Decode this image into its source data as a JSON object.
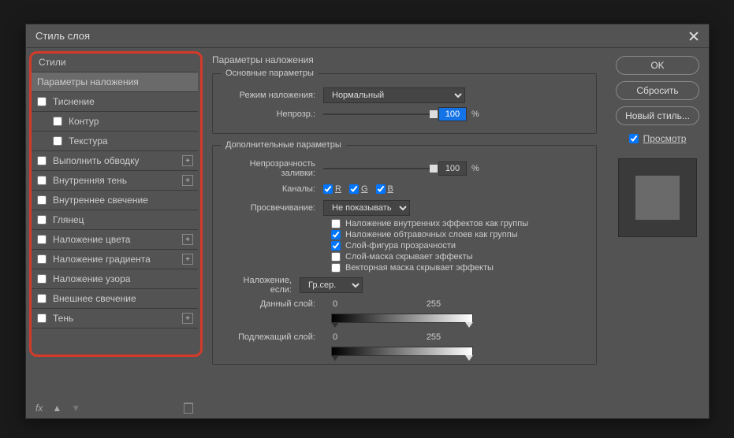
{
  "dialog": {
    "title": "Стиль слоя"
  },
  "sidebar": {
    "styles_header": "Стили",
    "blending_options": "Параметры наложения",
    "items": [
      {
        "label": "Тиснение",
        "checked": false,
        "plus": false,
        "indent": false
      },
      {
        "label": "Контур",
        "checked": false,
        "plus": false,
        "indent": true
      },
      {
        "label": "Текстура",
        "checked": false,
        "plus": false,
        "indent": true
      },
      {
        "label": "Выполнить обводку",
        "checked": false,
        "plus": true,
        "indent": false
      },
      {
        "label": "Внутренняя тень",
        "checked": false,
        "plus": true,
        "indent": false
      },
      {
        "label": "Внутреннее свечение",
        "checked": false,
        "plus": false,
        "indent": false
      },
      {
        "label": "Глянец",
        "checked": false,
        "plus": false,
        "indent": false
      },
      {
        "label": "Наложение цвета",
        "checked": false,
        "plus": true,
        "indent": false
      },
      {
        "label": "Наложение градиента",
        "checked": false,
        "plus": true,
        "indent": false
      },
      {
        "label": "Наложение узора",
        "checked": false,
        "plus": false,
        "indent": false
      },
      {
        "label": "Внешнее свечение",
        "checked": false,
        "plus": false,
        "indent": false
      },
      {
        "label": "Тень",
        "checked": false,
        "plus": true,
        "indent": false
      }
    ],
    "fx_label": "fx"
  },
  "main": {
    "section_title": "Параметры наложения",
    "general": {
      "legend": "Основные параметры",
      "blend_mode_label": "Режим наложения:",
      "blend_mode_value": "Нормальный",
      "opacity_label": "Непрозр.:",
      "opacity_value": "100",
      "opacity_unit": "%"
    },
    "advanced": {
      "legend": "Дополнительные параметры",
      "fill_opacity_label": "Непрозрачность заливки:",
      "fill_opacity_value": "100",
      "fill_opacity_unit": "%",
      "channels_label": "Каналы:",
      "channel_r": "R",
      "channel_g": "G",
      "channel_b": "B",
      "knockout_label": "Просвечивание:",
      "knockout_value": "Не показывать",
      "opt1": "Наложение внутренних эффектов как группы",
      "opt2": "Наложение обтравочных слоев как группы",
      "opt3": "Слой-фигура прозрачности",
      "opt4": "Слой-маска скрывает эффекты",
      "opt5": "Векторная маска скрывает эффекты"
    },
    "blend_if": {
      "label": "Наложение, если:",
      "value": "Гр.сер.",
      "this_layer_label": "Данный слой:",
      "this_v0": "0",
      "this_v1": "255",
      "under_layer_label": "Подлежащий слой:",
      "under_v0": "0",
      "under_v1": "255"
    }
  },
  "right": {
    "ok": "OK",
    "reset": "Сбросить",
    "new_style": "Новый стиль...",
    "preview": "Просмотр"
  }
}
